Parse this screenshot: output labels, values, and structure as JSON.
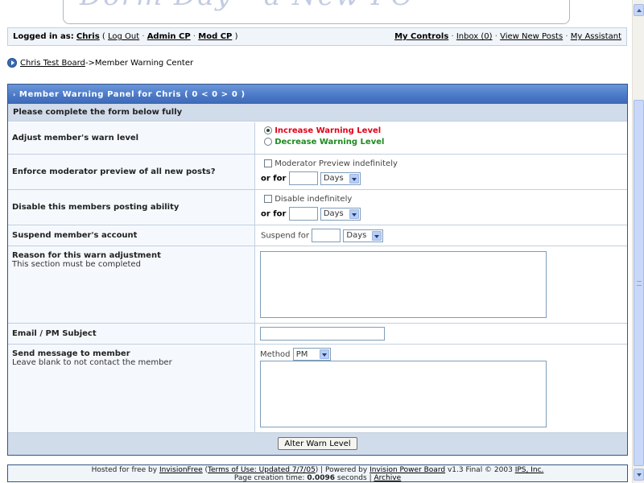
{
  "logo": {
    "text": "Dorm Day - a New PC"
  },
  "userbar": {
    "logged_in_prefix": "Logged in as:",
    "user": "Chris",
    "logout": "Log Out",
    "admin_cp": "Admin CP",
    "mod_cp": "Mod CP",
    "my_controls": "My Controls",
    "inbox": "Inbox (0)",
    "view_new_posts": "View New Posts",
    "my_assistant": "My Assistant"
  },
  "breadcrumb": {
    "board": "Chris Test Board",
    "current": "->Member Warning Center"
  },
  "panel": {
    "title": "Member Warning Panel for Chris ( 0 < 0 > 0 )",
    "subtitle": "Please complete the form below fully",
    "rows": {
      "warn_level": {
        "label": "Adjust member's warn level",
        "increase": "Increase Warning Level",
        "decrease": "Decrease Warning Level",
        "increase_color": "#e0001b",
        "decrease_color": "#1f8a1f",
        "selected": "increase"
      },
      "mod_preview": {
        "label": "Enforce moderator preview of all new posts?",
        "checkbox_label": "Moderator Preview indefinitely",
        "or_for": "or for",
        "unit": "Days"
      },
      "posting": {
        "label": "Disable this members posting ability",
        "checkbox_label": "Disable indefinitely",
        "or_for": "or for",
        "unit": "Days"
      },
      "suspend": {
        "label": "Suspend member's account",
        "prefix": "Suspend for",
        "unit": "Days"
      },
      "reason": {
        "label": "Reason for this warn adjustment",
        "desc": "This section must be completed"
      },
      "subject": {
        "label": "Email / PM Subject"
      },
      "message": {
        "label": "Send message to member",
        "desc": "Leave blank to not contact the member",
        "method_label": "Method",
        "method_value": "PM"
      }
    },
    "submit": "Alter Warn Level"
  },
  "copyright": {
    "hosted": "Hosted for free by",
    "invisionfree": "InvisionFree",
    "terms": "Terms of Use: Updated 7/7/05",
    "powered": ") | Powered by",
    "ipb": "Invision Power Board",
    "version": "v1.3 Final © 2003",
    "ips": "IPS, Inc.",
    "page_time_prefix": "Page creation time:",
    "page_time": "0.0096",
    "page_time_suffix": "seconds |",
    "archive": "Archive"
  }
}
